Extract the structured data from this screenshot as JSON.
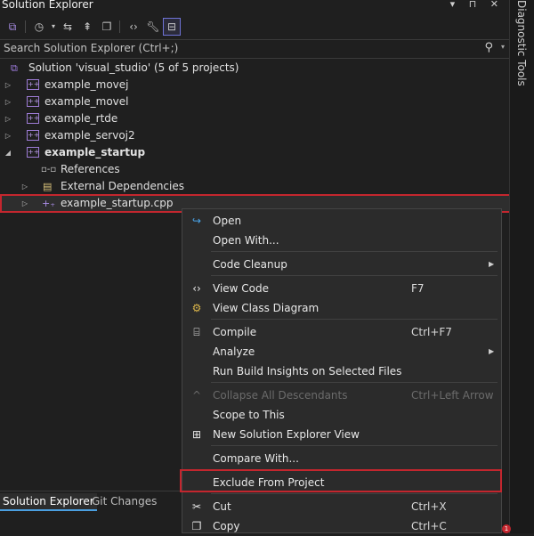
{
  "window": {
    "title": "Solution Explorer",
    "controls": "▾ ⊓ ✕"
  },
  "side_panel": {
    "label": "Diagnostic Tools"
  },
  "search": {
    "placeholder": "Search Solution Explorer (Ctrl+;)"
  },
  "toolbar": {
    "icons": [
      "vs-switch-views-icon",
      "history-icon",
      "sync-icon",
      "collapse-all-icon",
      "show-all-files-icon",
      "code-view-icon",
      "properties-wrench-icon",
      "preview-selected-icon"
    ]
  },
  "tree": {
    "solution": "Solution 'visual_studio' (5 of 5 projects)",
    "projects": [
      {
        "label": "example_movej"
      },
      {
        "label": "example_movel"
      },
      {
        "label": "example_rtde"
      },
      {
        "label": "example_servoj2"
      },
      {
        "label": "example_startup"
      }
    ],
    "children": {
      "references": "References",
      "external": "External Dependencies",
      "file": "example_startup.cpp"
    }
  },
  "context_menu": {
    "open": "Open",
    "open_with": "Open With...",
    "code_cleanup": "Code Cleanup",
    "view_code": "View Code",
    "view_code_key": "F7",
    "view_class_diagram": "View Class Diagram",
    "compile": "Compile",
    "compile_key": "Ctrl+F7",
    "analyze": "Analyze",
    "run_build_insights": "Run Build Insights on Selected Files",
    "collapse_all": "Collapse All Descendants",
    "collapse_all_key": "Ctrl+Left Arrow",
    "scope_to_this": "Scope to This",
    "new_se_view": "New Solution Explorer View",
    "compare_with": "Compare With...",
    "exclude": "Exclude From Project",
    "cut": "Cut",
    "cut_key": "Ctrl+X",
    "copy": "Copy",
    "copy_key": "Ctrl+C"
  },
  "bottom_tabs": {
    "solution_explorer": "Solution Explorer",
    "git_changes": "Git Changes"
  },
  "colors": {
    "highlight_box": "#c4262e",
    "accent": "#a07de0"
  }
}
